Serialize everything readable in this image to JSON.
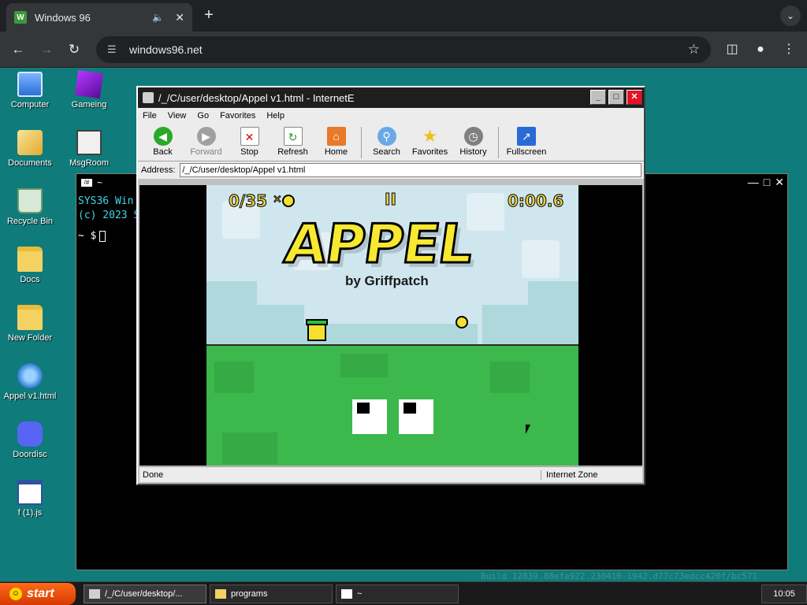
{
  "browser": {
    "tab_title": "Windows 96",
    "url": "windows96.net",
    "favicon_label": "W"
  },
  "desktop": {
    "icons": [
      {
        "label": "Computer"
      },
      {
        "label": "Gameing"
      },
      {
        "label": "Documents"
      },
      {
        "label": "MsgRoom"
      },
      {
        "label": "Recycle Bin"
      },
      {
        "label": "Docs"
      },
      {
        "label": "New Folder"
      },
      {
        "label": "Appel v1.html"
      },
      {
        "label": "Doordisc"
      },
      {
        "label": "f (1).js"
      }
    ]
  },
  "terminal": {
    "title": "~",
    "line1": "SYS36 Win",
    "line2": "(c) 2023 S",
    "prompt": "~ $",
    "build": "Build 12839.88efa922.230410-1942.d77c73edcc420f/bc571"
  },
  "ie": {
    "title": "/_/C/user/desktop/Appel v1.html - InternetE",
    "menu": [
      "File",
      "View",
      "Go",
      "Favorites",
      "Help"
    ],
    "toolbar": {
      "back": "Back",
      "forward": "Forward",
      "stop": "Stop",
      "refresh": "Refresh",
      "home": "Home",
      "search": "Search",
      "favorites": "Favorites",
      "history": "History",
      "fullscreen": "Fullscreen"
    },
    "address_label": "Address:",
    "address_value": "/_/C/user/desktop/Appel v1.html",
    "status": "Done",
    "zone": "Internet Zone"
  },
  "game": {
    "apples": "0/35",
    "multiplier": "×",
    "pause": "II",
    "timer": "0:00.6",
    "logo": "APPEL",
    "byline": "by Griffpatch"
  },
  "taskbar": {
    "start": "start",
    "tasks": [
      "/_/C/user/desktop/...",
      "programs",
      "~"
    ],
    "clock": "10:05"
  },
  "colors": {
    "desktop": "#0f7b7b",
    "start": "#ff6a1a",
    "grass": "#3cb84c",
    "logo": "#f7e830"
  }
}
